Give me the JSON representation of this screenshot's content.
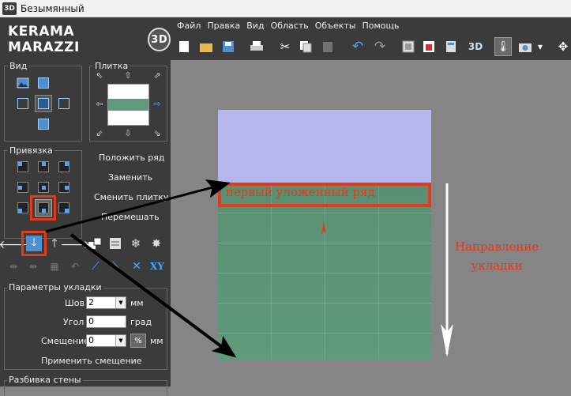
{
  "window": {
    "app_icon": "3D",
    "title": "Безымянный"
  },
  "logo": {
    "text": "KERAMA MARAZZI",
    "badge": "3D"
  },
  "menu": [
    "Файл",
    "Правка",
    "Вид",
    "Область",
    "Объекты",
    "Помощь"
  ],
  "toolbar": {
    "view3d_label": "3D",
    "icons": [
      "new-file-icon",
      "open-folder-icon",
      "save-icon",
      "print-icon",
      "cut-icon",
      "copy-icon",
      "paste-icon",
      "undo-icon",
      "redo-icon",
      "frame-icon",
      "wall-image-icon",
      "calculator-icon",
      "3d-view-icon",
      "thermometer-icon",
      "camera-icon",
      "chevron-down-icon",
      "move-icon"
    ]
  },
  "panel": {
    "view_label": "Вид",
    "tile_label": "Плитка",
    "snap_label": "Привязка",
    "actions": [
      "Положить ряд",
      "Заменить",
      "Сменить плитку",
      "Перемешать"
    ],
    "xy_label": "XY",
    "params_label": "Параметры укладки",
    "seam": {
      "label": "Шов",
      "value": "2",
      "unit": "мм"
    },
    "angle": {
      "label": "Угол",
      "value": "0",
      "unit": "град"
    },
    "offset": {
      "label": "Смещение",
      "value": "0",
      "unit_button": "%",
      "unit": "мм"
    },
    "apply_offset": "Применить смещение",
    "wall_split_label": "Разбивка стены"
  },
  "canvas": {
    "first_row_label": "первый уложенный ряд",
    "direction_line1": "Направление",
    "direction_line2": "укладки"
  },
  "colors": {
    "annotation_red": "#e53a1a",
    "tile_green": "#5f9a7d",
    "wall_lavender": "#b6b5ec",
    "panel_bg": "#3b3b3b"
  }
}
